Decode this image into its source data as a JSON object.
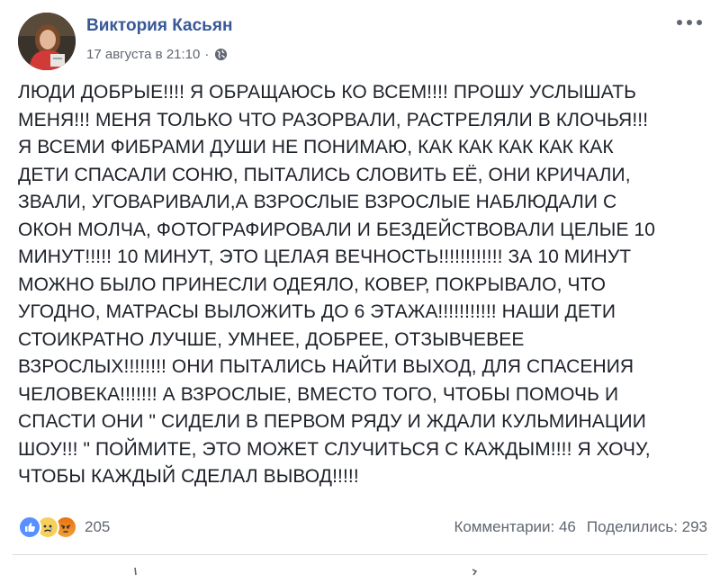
{
  "post": {
    "author": "Виктория Касьян",
    "date": "17 августа в 21:10",
    "separator": "·",
    "text_lines": [
      "ЛЮДИ ДОБРЫЕ!!!! Я ОБРАЩАЮСЬ КО ВСЕМ!!!! ПРОШУ УСЛЫШАТЬ",
      "МЕНЯ!!! МЕНЯ ТОЛЬКО ЧТО РАЗОРВАЛИ, РАСТРЕЛЯЛИ В КЛОЧЬЯ!!!",
      "Я ВСЕМИ ФИБРАМИ ДУШИ НЕ ПОНИМАЮ, КАК КАК КАК КАК КАК",
      "ДЕТИ СПАСАЛИ СОНЮ, ПЫТАЛИСЬ СЛОВИТЬ ЕЁ, ОНИ КРИЧАЛИ,",
      "ЗВАЛИ, УГОВАРИВАЛИ,А ВЗРОСЛЫЕ ВЗРОСЛЫЕ НАБЛЮДАЛИ С",
      "ОКОН МОЛЧА, ФОТОГРАФИРОВАЛИ И БЕЗДЕЙСТВОВАЛИ ЦЕЛЫЕ 10",
      "МИНУТ!!!!! 10 МИНУТ, ЭТО ЦЕЛАЯ ВЕЧНОСТЬ!!!!!!!!!!!! ЗА 10 МИНУТ",
      "МОЖНО БЫЛО ПРИНЕСЛИ ОДЕЯЛО, КОВЕР, ПОКРЫВАЛО, ЧТО",
      "УГОДНО, МАТРАСЫ ВЫЛОЖИТЬ ДО 6 ЭТАЖА!!!!!!!!!!! НАШИ ДЕТИ",
      "СТОИКРАТНО ЛУЧШЕ, УМНЕЕ, ДОБРЕЕ, ОТЗЫВЧЕВЕЕ",
      "ВЗРОСЛЫХ!!!!!!!! ОНИ ПЫТАЛИСЬ НАЙТИ ВЫХОД, ДЛЯ СПАСЕНИЯ",
      "ЧЕЛОВЕКА!!!!!!! А ВЗРОСЛЫЕ, ВМЕСТО ТОГО, ЧТОБЫ ПОМОЧЬ И",
      "СПАСТИ ОНИ \" СИДЕЛИ В ПЕРВОМ РЯДУ И ЖДАЛИ КУЛЬМИНАЦИИ",
      "ШОУ!!! \" ПОЙМИТЕ, ЭТО МОЖЕТ СЛУЧИТЬСЯ С КАЖДЫМ!!!! Я ХОЧУ,",
      "ЧТОБЫ КАЖДЫЙ СДЕЛАЛ ВЫВОД!!!!!"
    ]
  },
  "icons": {
    "privacy": "globe-icon",
    "menu": "more-options-icon",
    "reactions": [
      "like-reaction-icon",
      "sad-reaction-icon",
      "angry-reaction-icon"
    ]
  },
  "footer": {
    "reaction_count": "205",
    "comments": "Комментарии: 46",
    "shares": "Поделились: 293"
  },
  "colors": {
    "author_link": "#385898",
    "meta_text": "#616770",
    "like_blue": "#5890ff",
    "sad_yellow": "#f7d05b",
    "angry_orange": "#e9710f"
  }
}
